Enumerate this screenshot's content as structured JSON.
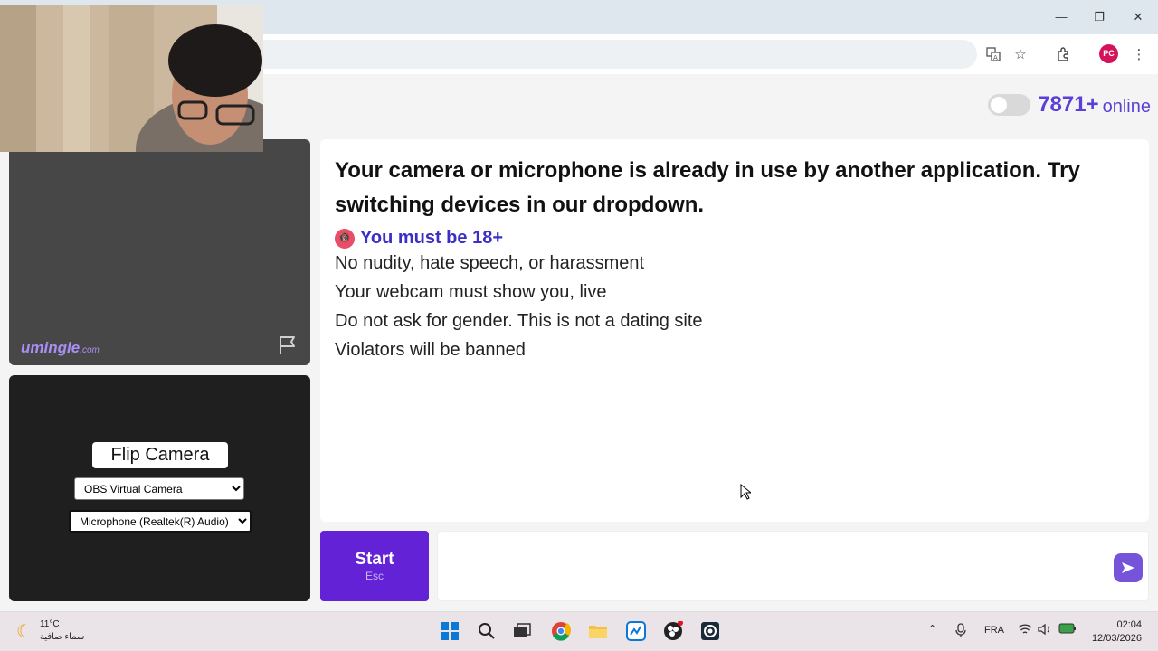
{
  "browser": {
    "window_controls": {
      "minimize": "—",
      "restore": "❐",
      "close": "✕"
    },
    "profile_initials": "PC"
  },
  "header": {
    "online_count": "7871+",
    "online_label": "online"
  },
  "stranger_panel": {
    "logo_main": "umingle",
    "logo_suffix": ".com"
  },
  "self_panel": {
    "flip_camera_label": "Flip Camera",
    "camera_select": {
      "selected": "OBS Virtual Camera"
    },
    "microphone_select": {
      "selected": "Microphone (Realtek(R) Audio)"
    }
  },
  "chat": {
    "error_message": "Your camera or microphone is already in use by another application. Try switching devices in our dropdown.",
    "age_icon": "🔞",
    "age_notice": "You must be 18+",
    "rules": [
      "No nudity, hate speech, or harassment",
      "Your webcam must show you, live",
      "Do not ask for gender. This is not a dating site",
      "Violators will be banned"
    ]
  },
  "controls": {
    "start_label": "Start",
    "start_shortcut": "Esc"
  },
  "taskbar": {
    "weather_temp": "11°C",
    "weather_desc": "سماء صافية",
    "language": "FRA",
    "time": "02:04",
    "date": "12/03/2026"
  },
  "colors": {
    "accent": "#6322d6",
    "online_text": "#5b3fd6",
    "age_text": "#3b2ec4"
  }
}
